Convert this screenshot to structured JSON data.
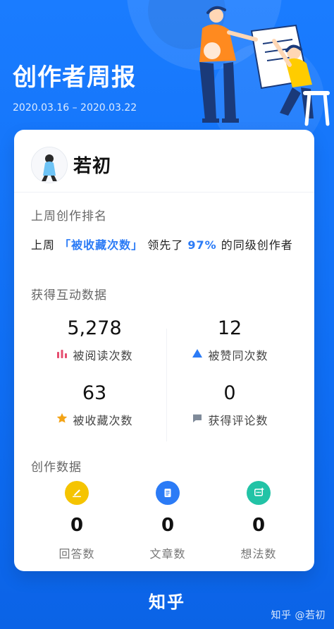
{
  "header": {
    "title": "创作者周报",
    "date_range": "2020.03.16 – 2020.03.22"
  },
  "profile": {
    "name": "若初"
  },
  "ranking": {
    "section_label": "上周创作排名",
    "prefix": "上周",
    "metric": "「被收藏次数」",
    "middle": "领先了",
    "percent": "97%",
    "suffix": "的同级创作者"
  },
  "interaction": {
    "section_label": "获得互动数据",
    "items": [
      {
        "value": "5,278",
        "label": "被阅读次数",
        "icon": "chart-icon",
        "color": "#e64d6f"
      },
      {
        "value": "12",
        "label": "被赞同次数",
        "icon": "triangle-up-icon",
        "color": "#2b7bf6"
      },
      {
        "value": "63",
        "label": "被收藏次数",
        "icon": "star-icon",
        "color": "#f3a316"
      },
      {
        "value": "0",
        "label": "获得评论数",
        "icon": "comment-icon",
        "color": "#7f8a99"
      }
    ]
  },
  "creation": {
    "section_label": "创作数据",
    "items": [
      {
        "value": "0",
        "label": "回答数",
        "icon": "edit-icon",
        "color": "#f5c400"
      },
      {
        "value": "0",
        "label": "文章数",
        "icon": "document-icon",
        "color": "#2b7bf6"
      },
      {
        "value": "0",
        "label": "想法数",
        "icon": "idea-icon",
        "color": "#22c3a6"
      }
    ]
  },
  "footer": {
    "brand": "知乎",
    "watermark": "知乎 @若初"
  }
}
